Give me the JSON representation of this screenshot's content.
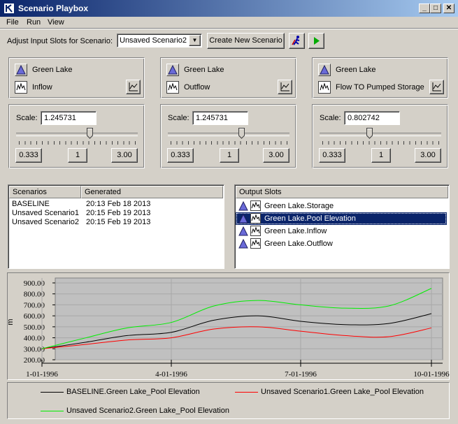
{
  "window": {
    "title": "Scenario Playbox"
  },
  "menu": [
    "File",
    "Run",
    "View"
  ],
  "toolbar": {
    "adjust_label": "Adjust Input Slots for Scenario:",
    "scenario_select": "Unsaved Scenario2",
    "create_button": "Create New Scenario"
  },
  "input_slots": [
    {
      "object": "Green Lake",
      "slot": "Inflow",
      "scale": "1.245731",
      "scale_value": 1.245731,
      "min_label": "0.333",
      "mid_label": "1",
      "max_label": "3.00"
    },
    {
      "object": "Green Lake",
      "slot": "Outflow",
      "scale": "1.245731",
      "scale_value": 1.245731,
      "min_label": "0.333",
      "mid_label": "1",
      "max_label": "3.00"
    },
    {
      "object": "Green Lake",
      "slot": "Flow TO Pumped Storage",
      "scale": "0.802742",
      "scale_value": 0.802742,
      "min_label": "0.333",
      "mid_label": "1",
      "max_label": "3.00"
    }
  ],
  "scale_label": "Scale:",
  "scenarios_table": {
    "headers": [
      "Scenarios",
      "Generated"
    ],
    "rows": [
      [
        "BASELINE",
        "20:13 Feb 18 2013"
      ],
      [
        "Unsaved Scenario1",
        "20:15 Feb 19 2013"
      ],
      [
        "Unsaved Scenario2",
        "20:15 Feb 19 2013"
      ]
    ]
  },
  "output_slots": {
    "header": "Output Slots",
    "items": [
      "Green Lake.Storage",
      "Green Lake.Pool Elevation",
      "Green Lake.Inflow",
      "Green Lake.Outflow"
    ],
    "selected_index": 1
  },
  "chart_data": {
    "type": "line",
    "ylabel": "m",
    "ylim": [
      200,
      900
    ],
    "y_ticks": [
      "900.00",
      "800.00",
      "700.00",
      "600.00",
      "500.00",
      "400.00",
      "300.00",
      "200.00"
    ],
    "x_ticks": [
      "1-01-1996",
      "4-01-1996",
      "7-01-1996",
      "10-01-1996"
    ],
    "grid": true,
    "series": [
      {
        "name": "BASELINE.Green Lake_Pool Elevation",
        "color": "#000000",
        "points": [
          [
            "1-01-1996",
            300
          ],
          [
            "2-01-1996",
            360
          ],
          [
            "3-01-1996",
            420
          ],
          [
            "4-01-1996",
            450
          ],
          [
            "5-01-1996",
            560
          ],
          [
            "6-01-1996",
            600
          ],
          [
            "7-01-1996",
            550
          ],
          [
            "8-01-1996",
            520
          ],
          [
            "9-01-1996",
            530
          ],
          [
            "10-01-1996",
            620
          ]
        ]
      },
      {
        "name": "Unsaved Scenario1.Green Lake_Pool Elevation",
        "color": "#ff0000",
        "points": [
          [
            "1-01-1996",
            300
          ],
          [
            "2-01-1996",
            340
          ],
          [
            "3-01-1996",
            380
          ],
          [
            "4-01-1996",
            400
          ],
          [
            "5-01-1996",
            480
          ],
          [
            "6-01-1996",
            500
          ],
          [
            "7-01-1996",
            460
          ],
          [
            "8-01-1996",
            420
          ],
          [
            "9-01-1996",
            410
          ],
          [
            "10-01-1996",
            490
          ]
        ]
      },
      {
        "name": "Unsaved Scenario2.Green Lake_Pool Elevation",
        "color": "#00ee00",
        "points": [
          [
            "1-01-1996",
            300
          ],
          [
            "2-01-1996",
            400
          ],
          [
            "3-01-1996",
            490
          ],
          [
            "4-01-1996",
            540
          ],
          [
            "5-01-1996",
            690
          ],
          [
            "6-01-1996",
            740
          ],
          [
            "7-01-1996",
            700
          ],
          [
            "8-01-1996",
            670
          ],
          [
            "9-01-1996",
            690
          ],
          [
            "10-01-1996",
            850
          ]
        ]
      }
    ]
  }
}
